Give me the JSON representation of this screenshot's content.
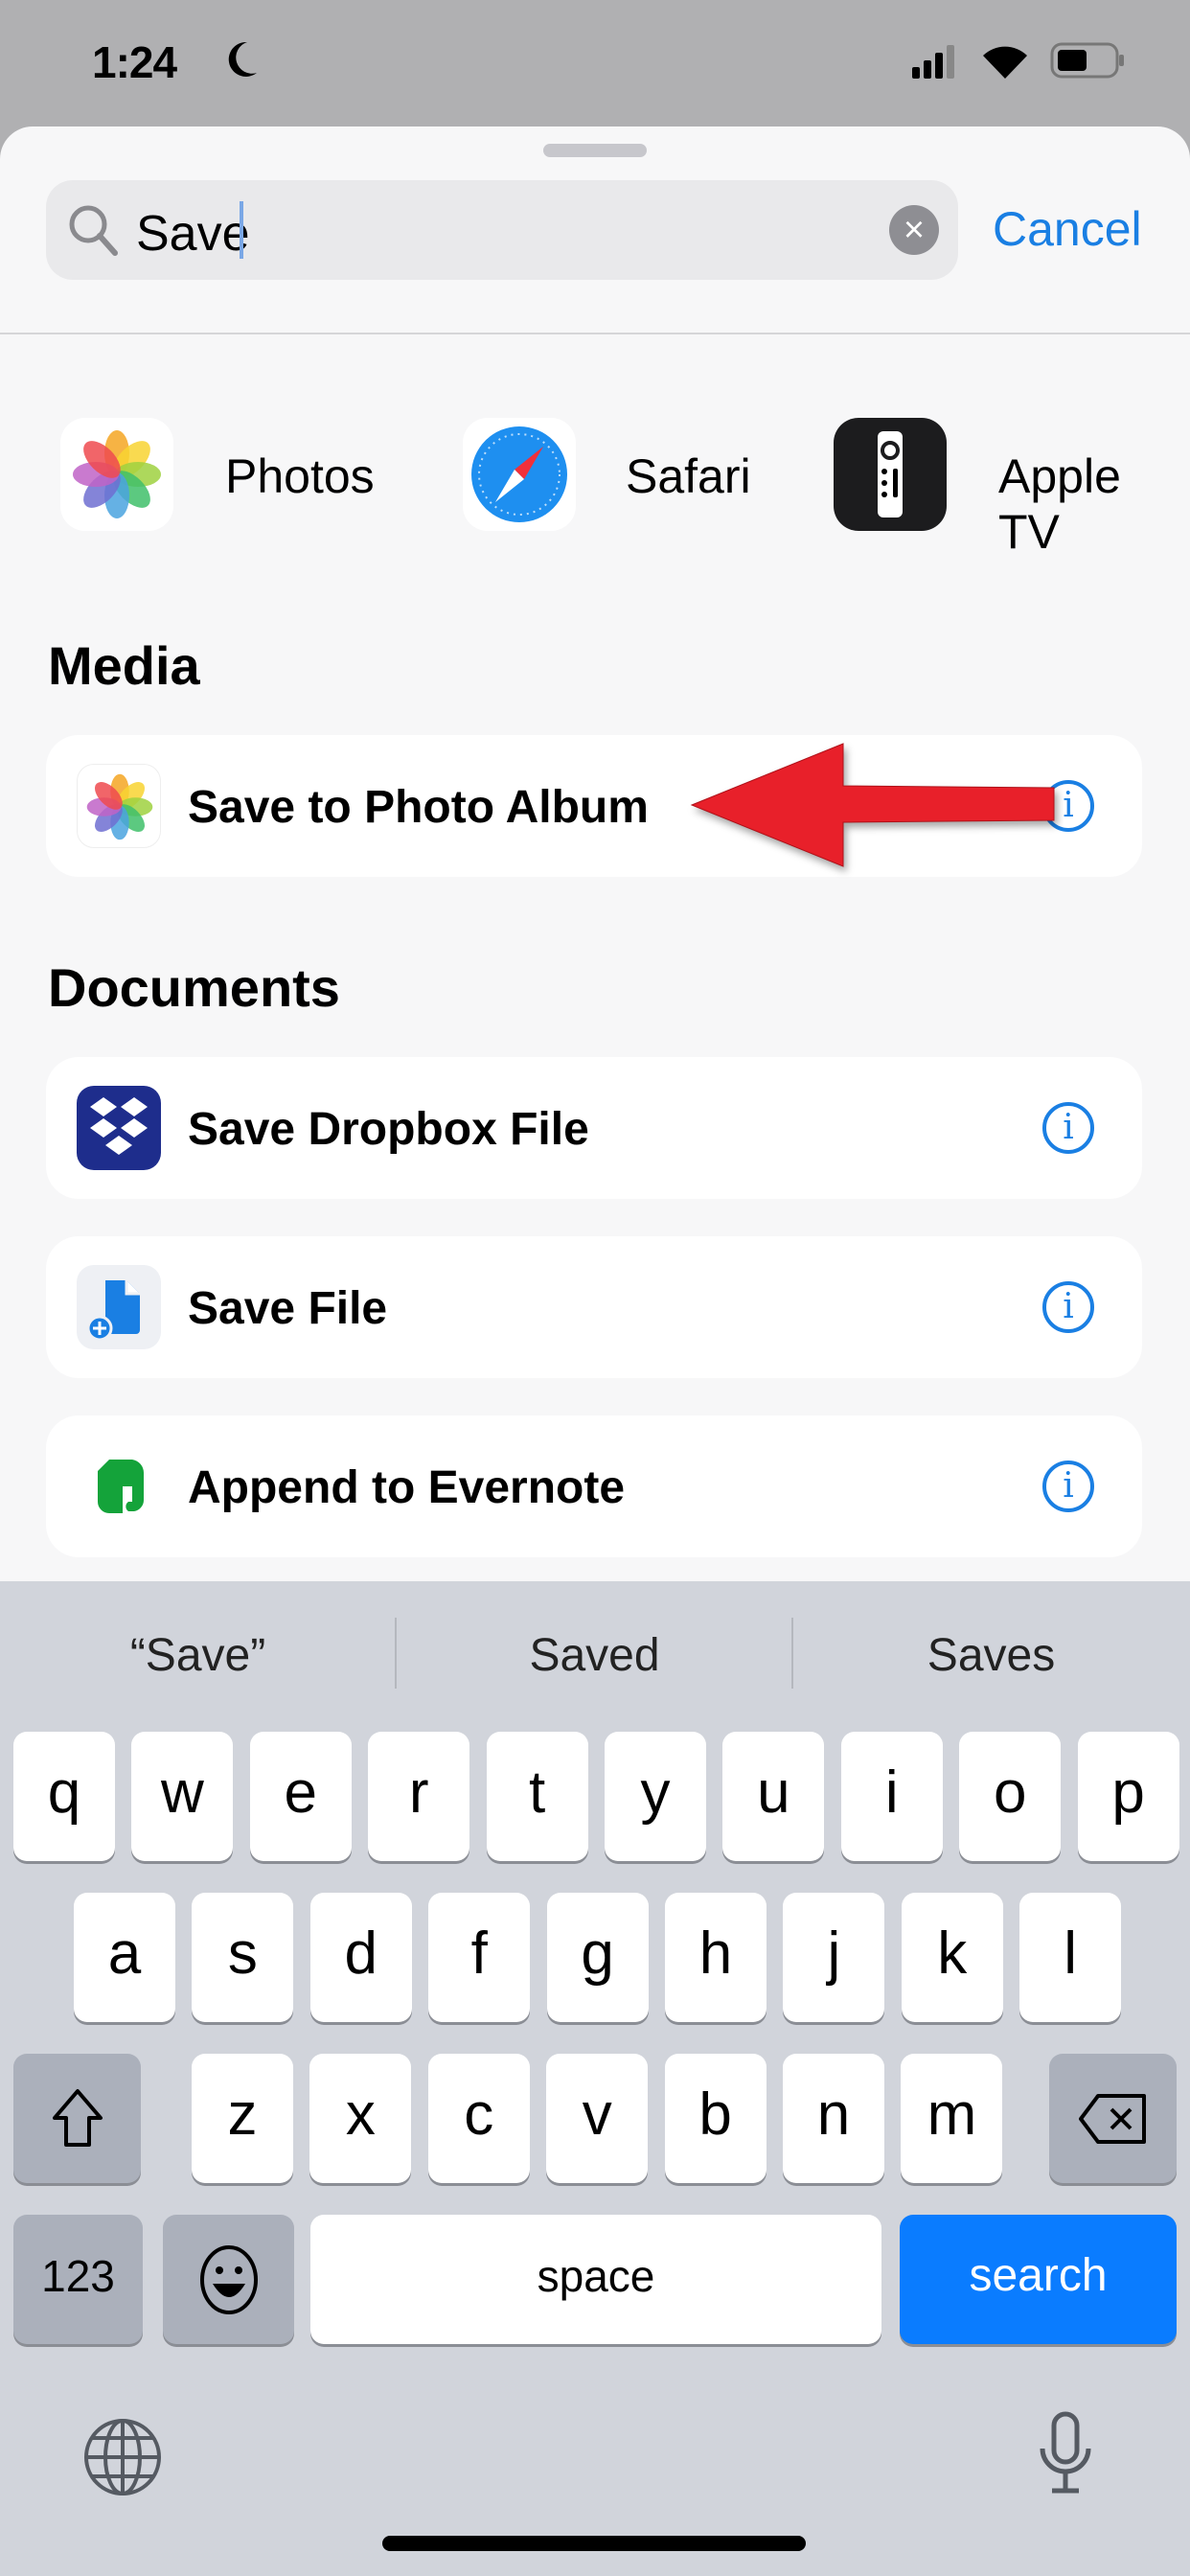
{
  "status": {
    "time": "1:24"
  },
  "search": {
    "value": "Save",
    "cancel": "Cancel"
  },
  "apps": [
    {
      "label": "Photos",
      "icon": "photos-icon"
    },
    {
      "label": "Safari",
      "icon": "safari-icon"
    },
    {
      "label": "Apple TV",
      "icon": "apple-tv-remote-icon"
    }
  ],
  "sections": [
    {
      "title": "Media",
      "items": [
        {
          "label": "Save to Photo Album",
          "icon": "photos-icon"
        }
      ]
    },
    {
      "title": "Documents",
      "items": [
        {
          "label": "Save Dropbox File",
          "icon": "dropbox-icon"
        },
        {
          "label": "Save File",
          "icon": "files-icon"
        },
        {
          "label": "Append to Evernote",
          "icon": "evernote-icon"
        }
      ]
    }
  ],
  "annotation": {
    "color": "#e8202a",
    "type": "arrow pointing left at Save to Photo Album"
  },
  "keyboard": {
    "suggestions": [
      "“Save”",
      "Saved",
      "Saves"
    ],
    "rows": [
      [
        "q",
        "w",
        "e",
        "r",
        "t",
        "y",
        "u",
        "i",
        "o",
        "p"
      ],
      [
        "a",
        "s",
        "d",
        "f",
        "g",
        "h",
        "j",
        "k",
        "l"
      ],
      [
        "z",
        "x",
        "c",
        "v",
        "b",
        "n",
        "m"
      ]
    ],
    "numbers": "123",
    "space": "space",
    "action": "search"
  },
  "colors": {
    "accent": "#1a7fe3",
    "search_key": "#0a7cff"
  }
}
